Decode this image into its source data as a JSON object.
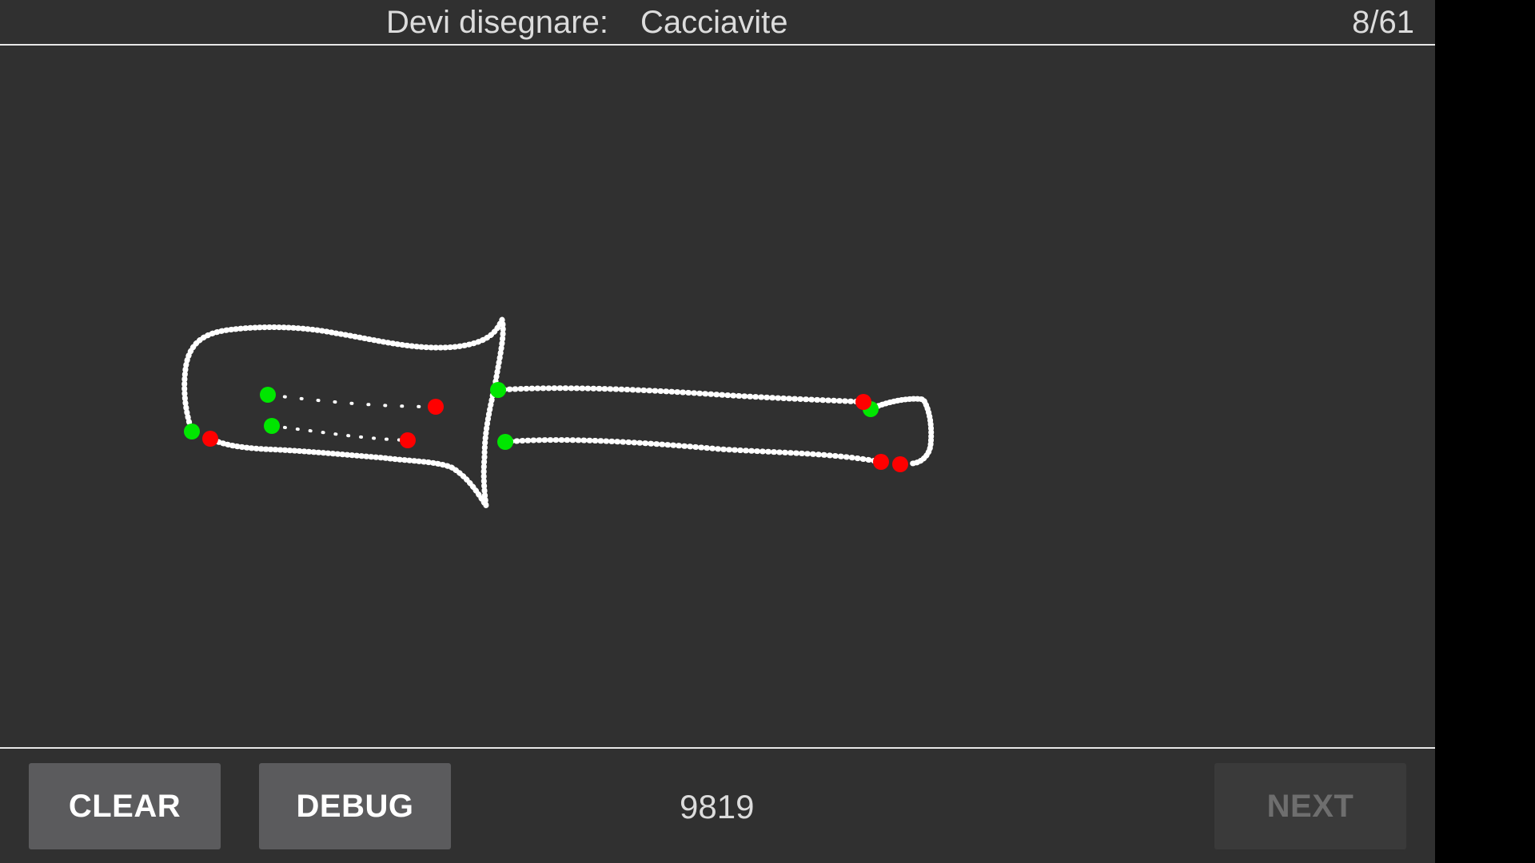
{
  "header": {
    "prompt_label": "Devi disegnare:",
    "prompt_word": "Cacciavite",
    "counter": "8/61"
  },
  "canvas": {
    "stroke_color": "#ffffff",
    "start_marker_color": "#00e600",
    "end_marker_color": "#ff0000",
    "background": "#303030"
  },
  "footer": {
    "clear_label": "CLEAR",
    "debug_label": "DEBUG",
    "score": "9819",
    "next_label": "NEXT",
    "next_enabled": false
  }
}
